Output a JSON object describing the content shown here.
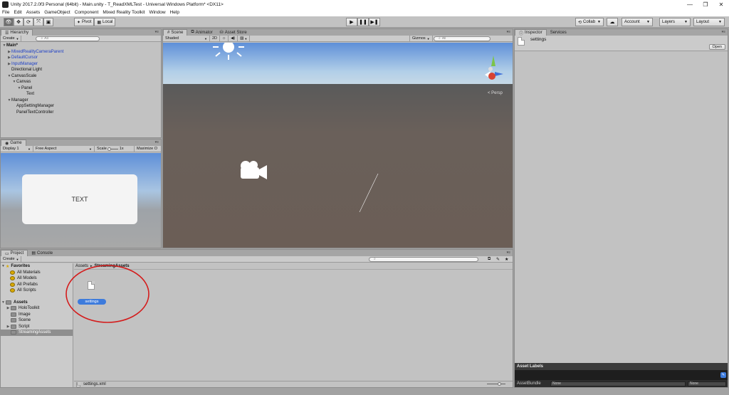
{
  "window": {
    "title": "Unity 2017.2.0f3 Personal (64bit) - Main.unity - T_ReadXMLTest - Universal Windows Platform* <DX11>",
    "minimize": "—",
    "maximize": "❐",
    "close": "✕"
  },
  "menu": [
    "File",
    "Edit",
    "Assets",
    "GameObject",
    "Component",
    "Mixed Reality Toolkit",
    "Window",
    "Help"
  ],
  "toolbar": {
    "pivot": "Pivot",
    "local": "Local",
    "collab": "Collab",
    "account": "Account",
    "layers": "Layers",
    "layout": "Layout"
  },
  "hierarchy": {
    "tab": "Hierarchy",
    "create": "Create",
    "search_placeholder": "All",
    "items": [
      {
        "label": "Main*",
        "depth": 0,
        "arrow": "▼",
        "style": "bold"
      },
      {
        "label": "MixedRealityCameraParent",
        "depth": 1,
        "arrow": "▶",
        "style": "blue"
      },
      {
        "label": "DefaultCursor",
        "depth": 1,
        "arrow": "▶",
        "style": "blue"
      },
      {
        "label": "InputManager",
        "depth": 1,
        "arrow": "▶",
        "style": "blue"
      },
      {
        "label": "Directional Light",
        "depth": 1,
        "arrow": "",
        "style": ""
      },
      {
        "label": "CanvasScale",
        "depth": 1,
        "arrow": "▼",
        "style": ""
      },
      {
        "label": "Canvas",
        "depth": 2,
        "arrow": "▼",
        "style": ""
      },
      {
        "label": "Panel",
        "depth": 3,
        "arrow": "▼",
        "style": ""
      },
      {
        "label": "Text",
        "depth": 4,
        "arrow": "",
        "style": ""
      },
      {
        "label": "Manager",
        "depth": 1,
        "arrow": "▼",
        "style": ""
      },
      {
        "label": "AppSettingManager",
        "depth": 2,
        "arrow": "",
        "style": ""
      },
      {
        "label": "PanelTextController",
        "depth": 2,
        "arrow": "",
        "style": ""
      }
    ]
  },
  "scene": {
    "tabs": [
      "Scene",
      "Animator",
      "Asset Store"
    ],
    "shaded": "Shaded",
    "mode_2d": "2D",
    "gizmos": "Gizmos",
    "search_placeholder": "All",
    "persp": "< Persp"
  },
  "game": {
    "tab": "Game",
    "display": "Display 1",
    "aspect": "Free Aspect",
    "scale_label": "Scale",
    "scale_value": "1x",
    "maximize": "Maximize O",
    "panel_text": "TEXT"
  },
  "project": {
    "tabs": [
      "Project",
      "Console"
    ],
    "create": "Create",
    "breadcrumb_root": "Assets",
    "breadcrumb_current": "StreamingAssets",
    "favorites": {
      "label": "Favorites",
      "items": [
        "All Materials",
        "All Models",
        "All Prefabs",
        "All Scripts"
      ]
    },
    "assets": {
      "label": "Assets",
      "items": [
        {
          "label": "HoloToolkit",
          "arrow": "▶"
        },
        {
          "label": "Image",
          "arrow": ""
        },
        {
          "label": "Scene",
          "arrow": ""
        },
        {
          "label": "Script",
          "arrow": "▶"
        },
        {
          "label": "StreamingAssets",
          "arrow": ""
        }
      ]
    },
    "file_name": "settings",
    "status_file": "settings.xml"
  },
  "inspector": {
    "tabs": [
      "Inspector",
      "Services"
    ],
    "asset_name": "settings",
    "open_button": "Open",
    "asset_labels": "Asset Labels",
    "asset_bundle": "AssetBundle",
    "bundle_none_1": "None",
    "bundle_none_2": "None"
  },
  "colors": {
    "selection_blue": "#3d7bdc",
    "annotation_red": "#d41c1c",
    "link_blue": "#1d3fc6"
  }
}
